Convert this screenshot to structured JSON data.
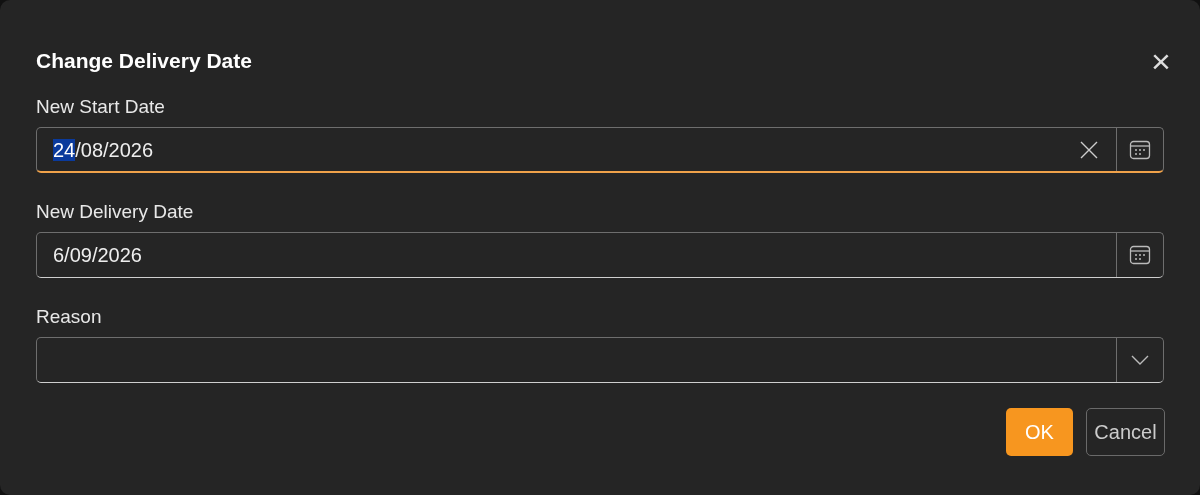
{
  "dialog": {
    "title": "Change Delivery Date",
    "close_glyph": "×"
  },
  "fields": [
    {
      "label": "New Start Date",
      "kind": "date",
      "selected_text": "24",
      "value": "/08/2026",
      "focused": true,
      "clearable": true
    },
    {
      "label": "New Delivery Date",
      "kind": "date",
      "value": "6/09/2026",
      "focused": false,
      "clearable": false
    },
    {
      "label": "Reason",
      "kind": "dropdown",
      "focused": false,
      "clearable": false
    }
  ],
  "buttons": [
    {
      "label": "OK",
      "kind": "primary"
    },
    {
      "label": "Cancel",
      "kind": "secondary"
    }
  ]
}
